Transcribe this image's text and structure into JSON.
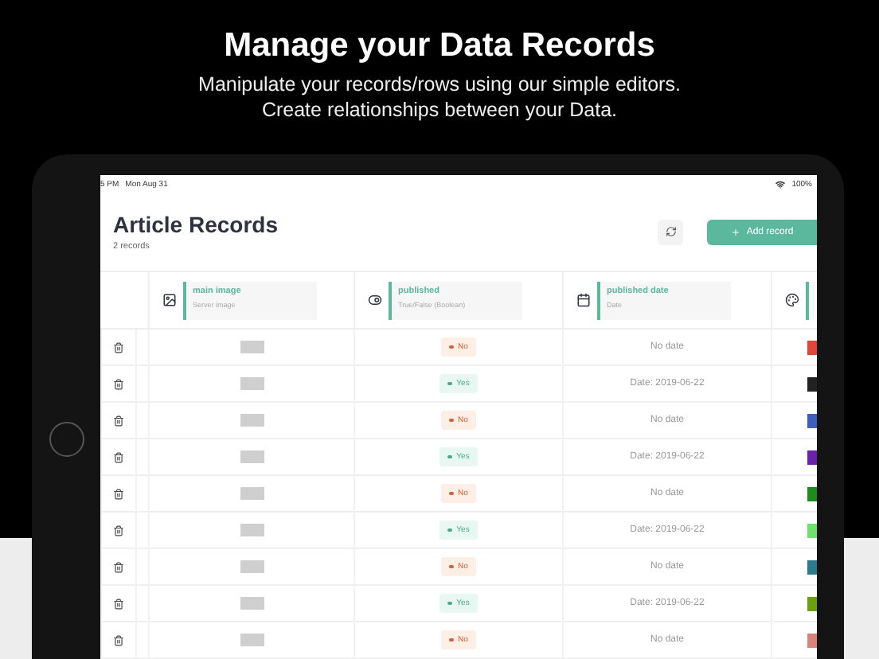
{
  "headline": "Manage your Data Records",
  "subtitle_lines": [
    "Manipulate your records/rows using our simple editors.",
    "Create relationships between your Data."
  ],
  "status_bar": {
    "time": "5 PM",
    "date": "Mon Aug 31",
    "battery": "100%"
  },
  "page": {
    "title": "Article Records",
    "count": "2 records",
    "add_button": "Add record"
  },
  "columns": [
    {
      "kind": "image",
      "name": "main image",
      "type": "Server image"
    },
    {
      "kind": "boolean",
      "name": "published",
      "type": "True/False (Boolean)"
    },
    {
      "kind": "date",
      "name": "published date",
      "type": "Date"
    },
    {
      "kind": "color"
    }
  ],
  "rows": [
    {
      "published": false,
      "label": "No",
      "date": "No date",
      "color": "#e0463a"
    },
    {
      "published": true,
      "label": "Yes",
      "date": "Date: 2019-06-22",
      "color": "#222222"
    },
    {
      "published": false,
      "label": "No",
      "date": "No date",
      "color": "#3f5fbf"
    },
    {
      "published": true,
      "label": "Yes",
      "date": "Date: 2019-06-22",
      "color": "#6a22a8"
    },
    {
      "published": false,
      "label": "No",
      "date": "No date",
      "color": "#1e8c1e"
    },
    {
      "published": true,
      "label": "Yes",
      "date": "Date: 2019-06-22",
      "color": "#6fe06f"
    },
    {
      "published": false,
      "label": "No",
      "date": "No date",
      "color": "#2e7a8c"
    },
    {
      "published": true,
      "label": "Yes",
      "date": "Date: 2019-06-22",
      "color": "#6aa012"
    },
    {
      "published": false,
      "label": "No",
      "date": "No date",
      "color": "#d8847a"
    }
  ]
}
